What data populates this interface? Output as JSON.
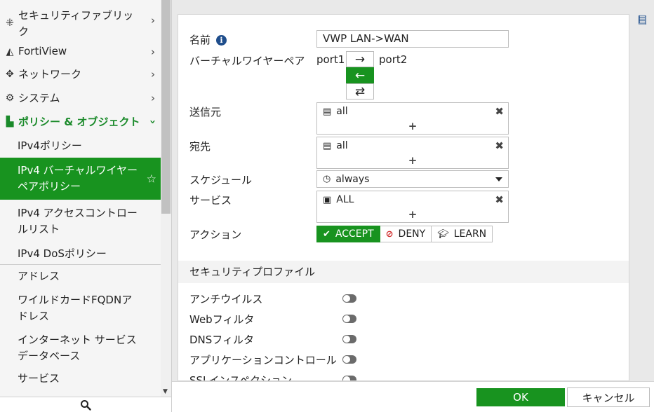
{
  "sidebar": {
    "sections": [
      {
        "label": "セキュリティファブリック",
        "icon": "security-fabric-icon"
      },
      {
        "label": "FortiView",
        "icon": "fortiview-icon"
      },
      {
        "label": "ネットワーク",
        "icon": "network-icon"
      },
      {
        "label": "システム",
        "icon": "gear-icon"
      },
      {
        "label": "ポリシー & オブジェクト",
        "icon": "policy-icon"
      }
    ],
    "sub_items": [
      {
        "label": "IPv4ポリシー"
      },
      {
        "label": "IPv4 バーチャルワイヤーペアポリシー",
        "selected": true
      },
      {
        "label": "IPv4 アクセスコントロールリスト"
      },
      {
        "label": "IPv4 DoSポリシー"
      },
      {
        "label": "アドレス"
      },
      {
        "label": "ワイルドカードFQDNアドレス"
      },
      {
        "label": "インターネット サービスデータベース"
      },
      {
        "label": "サービス"
      }
    ]
  },
  "form": {
    "name_label": "名前",
    "name_value": "VWP LAN->WAN",
    "vwp_label": "バーチャルワイヤーペア",
    "vwp_left_port": "port1",
    "vwp_right_port": "port2",
    "vwp_directions": [
      "→",
      "←",
      "⇄"
    ],
    "vwp_selected_direction": "←",
    "source_label": "送信元",
    "source_value": "all",
    "destination_label": "宛先",
    "destination_value": "all",
    "schedule_label": "スケジュール",
    "schedule_value": "always",
    "service_label": "サービス",
    "service_value": "ALL",
    "action_label": "アクション",
    "actions": [
      "ACCEPT",
      "DENY",
      "LEARN"
    ],
    "action_selected": "ACCEPT",
    "add_symbol": "+",
    "remove_symbol": "✖"
  },
  "security_profiles": {
    "header": "セキュリティプロファイル",
    "items": [
      {
        "label": "アンチウイルス",
        "enabled": false
      },
      {
        "label": "Webフィルタ",
        "enabled": false
      },
      {
        "label": "DNSフィルタ",
        "enabled": false
      },
      {
        "label": "アプリケーションコントロール",
        "enabled": false
      },
      {
        "label": "SSLインスペクション",
        "enabled": false
      }
    ]
  },
  "footer": {
    "ok_label": "OK",
    "cancel_label": "キャンセル"
  },
  "colors": {
    "accent_green": "#18931f",
    "deny_red": "#d12d2d",
    "info_blue": "#1f4e8c"
  }
}
